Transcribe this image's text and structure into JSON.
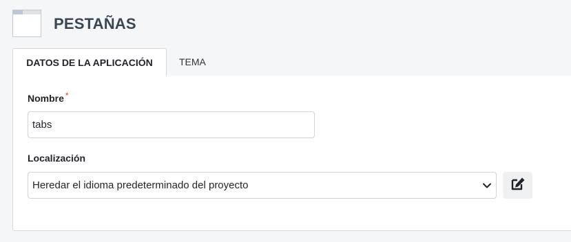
{
  "header": {
    "title": "PESTAÑAS",
    "icon": "window-icon"
  },
  "tabs": [
    {
      "label": "DATOS DE LA APLICACIÓN",
      "active": true
    },
    {
      "label": "TEMA",
      "active": false
    }
  ],
  "form": {
    "name_label": "Nombre",
    "required_marker": "*",
    "name_value": "tabs",
    "locale_label": "Localización",
    "locale_selected": "Heredar el idioma predeterminado del proyecto",
    "edit_icon": "edit-icon"
  },
  "colors": {
    "title": "#3a4654",
    "required": "#d9382c",
    "border": "#d4d7db",
    "button_bg": "#eef0f2"
  }
}
